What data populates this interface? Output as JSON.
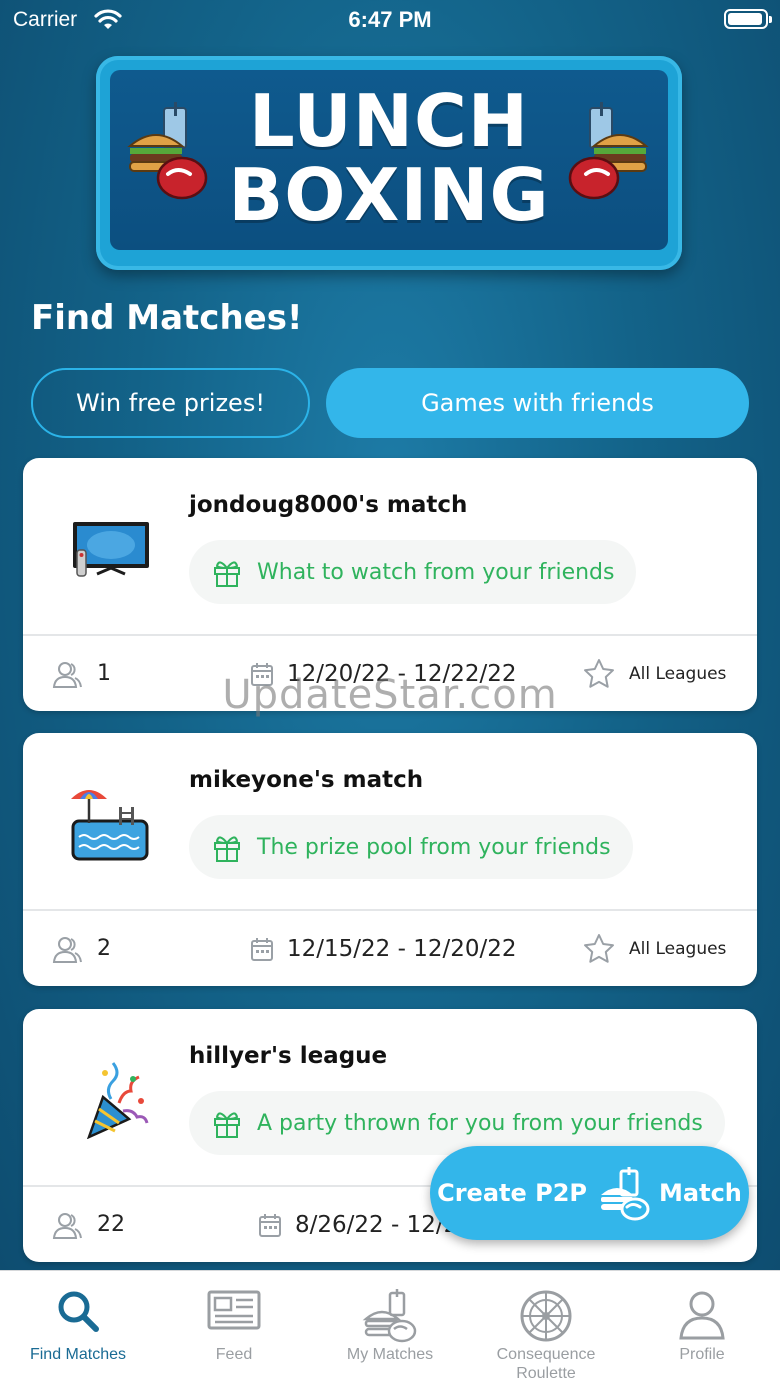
{
  "status_bar": {
    "carrier": "Carrier",
    "time": "6:47 PM"
  },
  "logo": {
    "line1": "LUNCH",
    "line2": "BOXING"
  },
  "section_title": "Find Matches!",
  "tabs": [
    {
      "label": "Win free prizes!",
      "selected": false
    },
    {
      "label": "Games with friends",
      "selected": true
    }
  ],
  "matches": [
    {
      "title": "jondoug8000's match",
      "prize": "What to watch from your friends",
      "players": "1",
      "dates": "12/20/22 - 12/22/22",
      "league": "All Leagues",
      "icon": "tv-icon"
    },
    {
      "title": "mikeyone's match",
      "prize": "The prize pool from your friends",
      "players": "2",
      "dates": "12/15/22 - 12/20/22",
      "league": "All Leagues",
      "icon": "pool-icon"
    },
    {
      "title": "hillyer's league",
      "prize": "A party thrown for you from your friends",
      "players": "22",
      "dates": "8/26/22 - 12/2",
      "league": "",
      "icon": "party-popper-icon"
    }
  ],
  "fab": {
    "left": "Create P2P",
    "right": "Match"
  },
  "watermark": "UpdateStar.com",
  "bottom_nav": [
    {
      "label": "Find Matches",
      "icon": "search-icon",
      "active": true
    },
    {
      "label": "Feed",
      "icon": "newspaper-icon",
      "active": false
    },
    {
      "label": "My Matches",
      "icon": "lunch-icon",
      "active": false
    },
    {
      "label": "Consequence Roulette",
      "icon": "roulette-wheel-icon",
      "active": false
    },
    {
      "label": "Profile",
      "icon": "person-icon",
      "active": false
    }
  ],
  "colors": {
    "accent": "#33b6ea",
    "prize_text": "#2fb35d",
    "nav_active": "#1a6b94",
    "background": "#136389"
  }
}
